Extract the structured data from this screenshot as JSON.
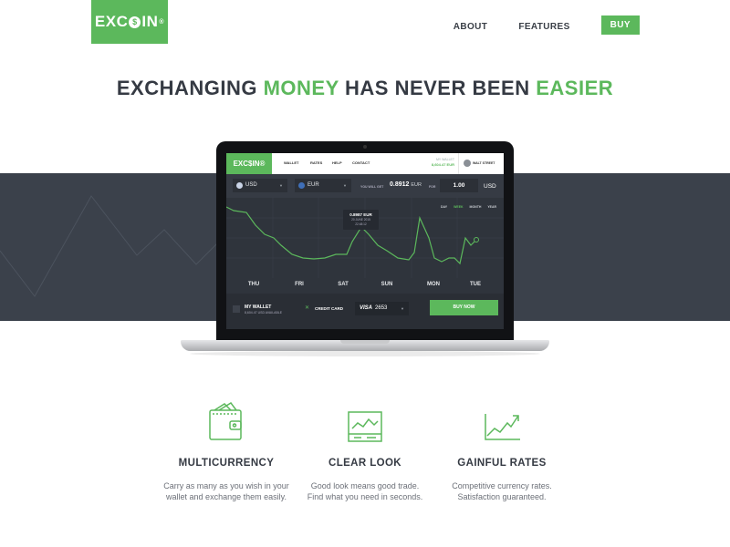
{
  "header": {
    "logo_text_pre": "EXC",
    "logo_coin": "$",
    "logo_text_post": "IN",
    "logo_reg": "®",
    "nav": [
      "ABOUT",
      "FEATURES"
    ],
    "buy_label": "BUY"
  },
  "headline": {
    "part1": "EXCHANGING ",
    "part2": "MONEY",
    "part3": " HAS NEVER BEEN ",
    "part4": "EASIER"
  },
  "app": {
    "logo": "EXC$IN®",
    "nav": [
      "WALLET",
      "RATES",
      "HELP",
      "CONTACT"
    ],
    "wallet_label": "MY WALLET",
    "wallet_value": "8,604.47 EUR",
    "user_name": "WALT STREET",
    "from_currency": "USD",
    "to_currency": "EUR",
    "you_will_get_label": "YOU WILL GET",
    "you_will_get_value": "0.8912",
    "you_will_get_unit": "EUR",
    "for_label": "FOR",
    "amount": "1.00",
    "amount_unit": "USD",
    "ranges": [
      "DAY",
      "WEEK",
      "MONTH",
      "YEAR"
    ],
    "active_range": "WEEK",
    "tooltip_value": "0.8987 EUR",
    "tooltip_date": "20 JUNE 2015",
    "tooltip_time": "22:48:12",
    "days": [
      "THU",
      "FRI",
      "SAT",
      "SUN",
      "MON",
      "TUE"
    ],
    "my_wallet_label": "MY WALLET",
    "my_wallet_available": "8,604.47 USD AVAILABLE",
    "credit_card_label": "CREDIT CARD",
    "card_brand": "VISA",
    "card_number": "2653",
    "buy_now_label": "BUY NOW"
  },
  "features": [
    {
      "title": "MULTICURRENCY",
      "line1": "Carry as many as you wish in your",
      "line2": "wallet and exchange them easily."
    },
    {
      "title": "CLEAR LOOK",
      "line1": "Good look means good trade.",
      "line2": "Find what you need in seconds."
    },
    {
      "title": "GAINFUL RATES",
      "line1": "Competitive currency rates.",
      "line2": "Satisfaction guaranteed."
    }
  ],
  "colors": {
    "accent": "#5cb85c",
    "dark": "#3b414b",
    "text": "#353a43"
  }
}
